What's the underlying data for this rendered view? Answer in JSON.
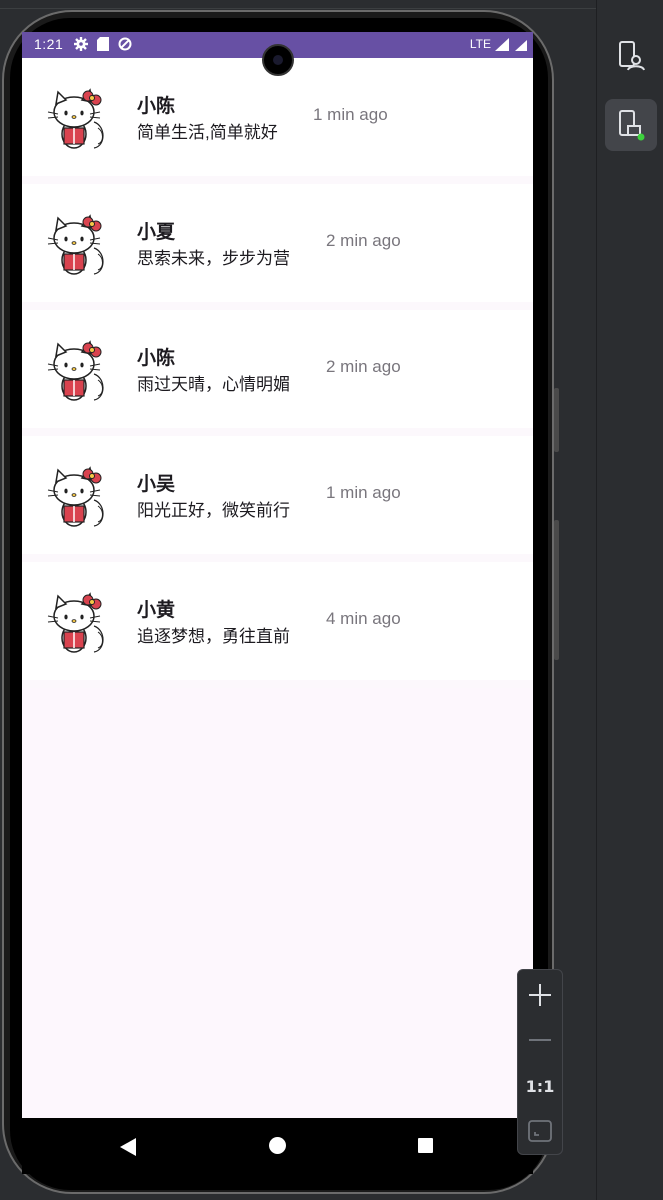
{
  "status_bar": {
    "time": "1:21",
    "network": "LTE"
  },
  "contacts": [
    {
      "name": "小陈",
      "message": "简单生活,简单就好",
      "time": "1 min ago"
    },
    {
      "name": "小夏",
      "message": "思索未来，步步为营",
      "time": "2 min ago"
    },
    {
      "name": "小陈",
      "message": "雨过天晴，心情明媚",
      "time": "2 min ago"
    },
    {
      "name": "小吴",
      "message": "阳光正好，微笑前行",
      "time": "1 min ago"
    },
    {
      "name": "小黄",
      "message": "追逐梦想，勇往直前",
      "time": "4 min ago"
    }
  ],
  "zoom_controls": {
    "zoom_in": "+",
    "zoom_out": "—",
    "actual_size": "1:1"
  },
  "colors": {
    "status_bar": "#6750a4",
    "screen_bg": "#fdf7fd",
    "ide_bg": "#2b2d30",
    "bow": "#d9434f"
  }
}
